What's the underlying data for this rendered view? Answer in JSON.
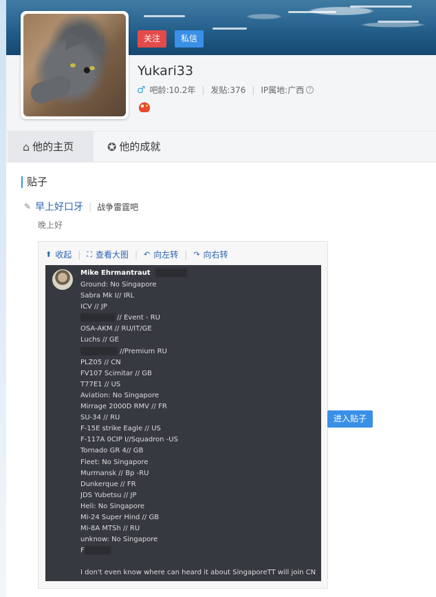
{
  "profile": {
    "follow_label": "关注",
    "message_label": "私信",
    "username": "Yukari33",
    "age": "吧龄:10.2年",
    "posts": "发贴:376",
    "ip": "IP属地:广西",
    "help_glyph": "?"
  },
  "tabs": [
    {
      "label": "他的主页",
      "icon": "home-icon"
    },
    {
      "label": "他的成就",
      "icon": "achievement-icon"
    }
  ],
  "section": {
    "title": "贴子"
  },
  "post": {
    "title": "早上好口牙",
    "forum": "战争雷霆吧",
    "desc": "晚上好",
    "enter_label": "进入贴子"
  },
  "toolbar": {
    "collapse": "收起",
    "view_large": "查看大图",
    "rotate_left": "向左转",
    "rotate_right": "向右转"
  },
  "screenshot": {
    "name": "Mike Ehrmantraut",
    "lines": [
      "Ground:    No Singapore",
      "Sabra Mk I// IRL",
      "ICV // JP",
      " // Event - RU",
      "OSA-AKM // RU/IT/GE",
      "Luchs // GE",
      " //Premium RU",
      "PLZ05 // CN",
      "FV107 Scimitar // GB",
      "T77E1 // US",
      "Aviation:    No Singapore",
      "Mirrage 2000D RMV // FR",
      "SU-34 // RU",
      "F-15E strike Eagle // US",
      "F-117A 0CIP I//Squadron -US",
      "Tornado GR 4// GB",
      "Fleet:    No Singapore",
      "Murmansk // Bp -RU",
      "Dunkerque // FR",
      "JDS Yubetsu // JP",
      "Heli:    No Singapore",
      "Mi-24 Super Hind // GB",
      "Mi-8A MTSh // RU",
      "unknow:    No Singapore",
      "F"
    ],
    "last_line": "I don't even know where can heard it about SingaporeTT will join CN"
  },
  "colors": {
    "accent_blue": "#3a8fe6",
    "follow_red": "#e54a4a",
    "link_blue": "#2d64b3",
    "discord_bg": "#36393f"
  }
}
